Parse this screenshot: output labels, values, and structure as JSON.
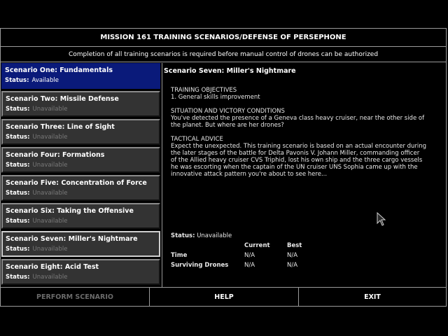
{
  "header": {
    "title": "MISSION 161 TRAINING SCENARIOS/DEFENSE OF PERSEPHONE",
    "subtitle": "Completion of all training scenarios is required before manual control of drones can be authorized"
  },
  "status_label": "Status:",
  "scenarios": [
    {
      "name": "Scenario One: Fundamentals",
      "status": "Available"
    },
    {
      "name": "Scenario Two: Missile Defense",
      "status": "Unavailable"
    },
    {
      "name": "Scenario Three: Line of Sight",
      "status": "Unavailable"
    },
    {
      "name": "Scenario Four: Formations",
      "status": "Unavailable"
    },
    {
      "name": "Scenario Five: Concentration of Force",
      "status": "Unavailable"
    },
    {
      "name": "Scenario Six: Taking the Offensive",
      "status": "Unavailable"
    },
    {
      "name": "Scenario Seven: Miller's Nightmare",
      "status": "Unavailable"
    },
    {
      "name": "Scenario Eight: Acid Test",
      "status": "Unavailable"
    }
  ],
  "detail": {
    "title": "Scenario Seven: Miller's Nightmare",
    "objectives_heading": "TRAINING OBJECTIVES",
    "objectives_lines": [
      "1. General skills improvement"
    ],
    "situation_heading": "SITUATION AND VICTORY CONDITIONS",
    "situation_lines": [
      "You've detected the presence of a Geneva class heavy cruiser, near the other side of",
      "the planet. But where are her drones?"
    ],
    "advice_heading": "TACTICAL ADVICE",
    "advice_lines": [
      "Expect the unexpected. This training scenario is based on an actual encounter during",
      "the later stages of the battle for Delta Pavonis V. Johann Miller, commanding officer",
      "of the Allied heavy cruiser CVS Triphid, lost his own ship and the three cargo vessels",
      "he was escorting when the captain of the UN cruiser UNS Sophia came up with the",
      "innovative attack pattern you're about to see here..."
    ],
    "status_label": "Status:",
    "status_value": "Unavailable",
    "col_current": "Current",
    "col_best": "Best",
    "row_time": "Time",
    "row_drones": "Surviving Drones",
    "time_current": "N/A",
    "time_best": "N/A",
    "drones_current": "N/A",
    "drones_best": "N/A"
  },
  "buttons": {
    "perform": "PERFORM SCENARIO",
    "help": "HELP",
    "exit": "EXIT"
  },
  "icons": {
    "cursor": "mouse-pointer-icon"
  },
  "colors": {
    "selected": "#0a1a7a",
    "panel": "#333333",
    "disabled_text": "#7a7a7a"
  }
}
